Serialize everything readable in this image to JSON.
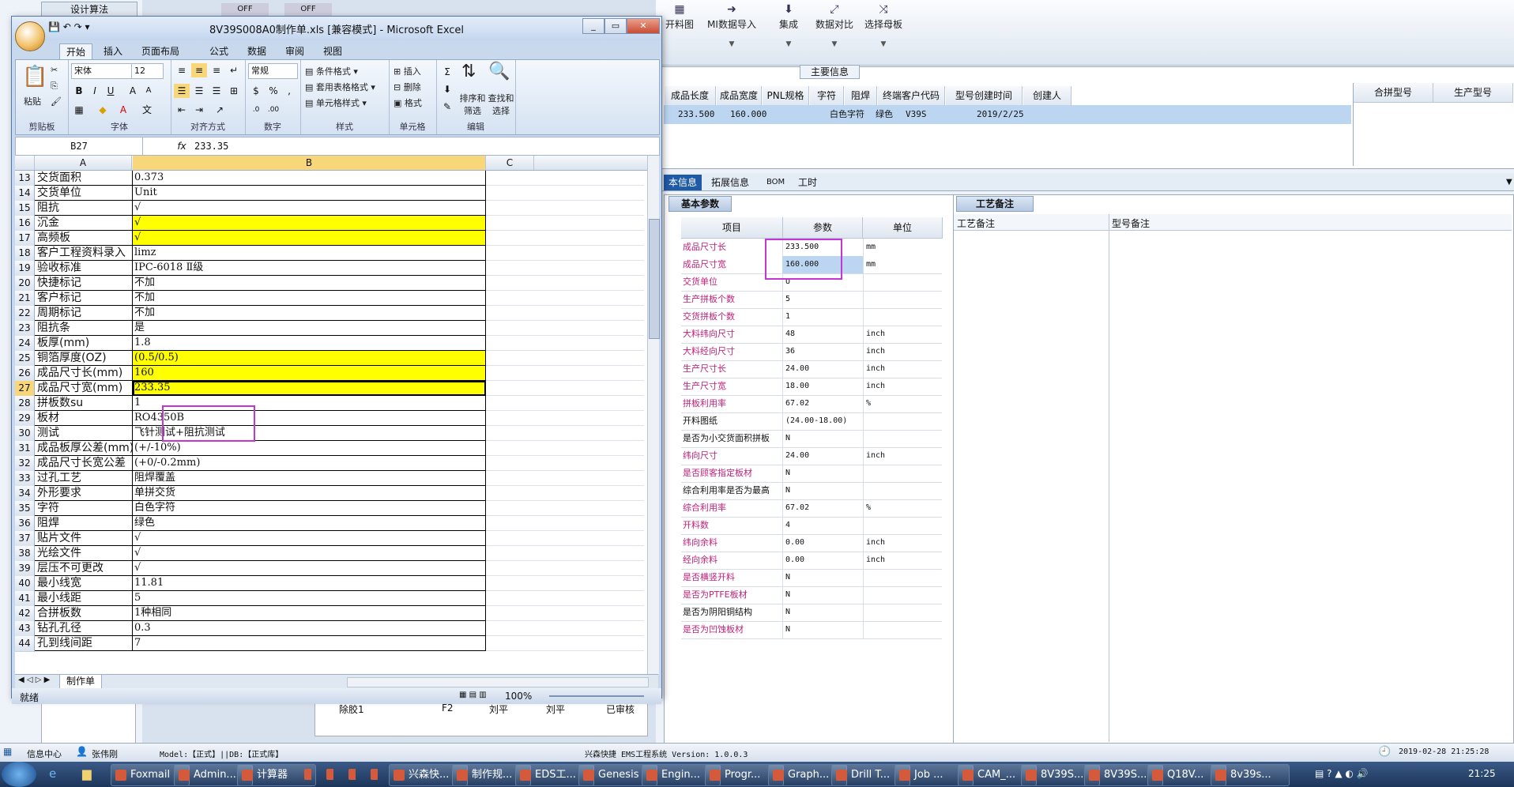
{
  "ems": {
    "top_left_label": "设计算法",
    "off1": "OFF",
    "off2": "OFF",
    "toolbar": [
      {
        "label": "开料图",
        "icon": "sheet-icon"
      },
      {
        "label": "MI数据导入",
        "icon": "import-icon"
      },
      {
        "label": "集成",
        "icon": "integrate-icon"
      },
      {
        "label": "数据对比",
        "icon": "compare-icon"
      },
      {
        "label": "选择母板",
        "icon": "select-board-icon"
      }
    ],
    "main_info_title": "主要信息",
    "main_grid": {
      "headers": [
        "成品长度",
        "成品宽度",
        "PNL规格",
        "字符",
        "阻焊",
        "终端客户代码",
        "型号创建时间",
        "创建人"
      ],
      "row": [
        "233.500",
        "160.000",
        "",
        "白色字符",
        "绿色",
        "V39S",
        "2019/2/25",
        ""
      ]
    },
    "right_grid_headers": [
      "合拼型号",
      "生产型号"
    ],
    "tabs": [
      "本信息",
      "拓展信息",
      "BOM",
      "工时"
    ],
    "basic_title": "基本参数",
    "param_headers": [
      "项目",
      "参数",
      "单位"
    ],
    "params": [
      {
        "name": "成品尺寸长",
        "value": "233.500",
        "unit": "mm",
        "pink": true
      },
      {
        "name": "成品尺寸宽",
        "value": "160.000",
        "unit": "mm",
        "pink": true
      },
      {
        "name": "交货单位",
        "value": "U",
        "unit": "",
        "pink": true
      },
      {
        "name": "生产拼板个数",
        "value": "5",
        "unit": "",
        "pink": true
      },
      {
        "name": "交货拼板个数",
        "value": "1",
        "unit": "",
        "pink": true
      },
      {
        "name": "大料纬向尺寸",
        "value": "48",
        "unit": "inch",
        "pink": true
      },
      {
        "name": "大料经向尺寸",
        "value": "36",
        "unit": "inch",
        "pink": true
      },
      {
        "name": "生产尺寸长",
        "value": "24.00",
        "unit": "inch",
        "pink": true
      },
      {
        "name": "生产尺寸宽",
        "value": "18.00",
        "unit": "inch",
        "pink": true
      },
      {
        "name": "拼板利用率",
        "value": "67.02",
        "unit": "%",
        "pink": true
      },
      {
        "name": "开料图纸",
        "value": "(24.00-18.00)",
        "unit": "",
        "pink": false
      },
      {
        "name": "是否为小交货面积拼板",
        "value": "N",
        "unit": "",
        "pink": false
      },
      {
        "name": "纬向尺寸",
        "value": "24.00",
        "unit": "inch",
        "pink": true
      },
      {
        "name": "是否顾客指定板材",
        "value": "N",
        "unit": "",
        "pink": true
      },
      {
        "name": "综合利用率是否为最高",
        "value": "N",
        "unit": "",
        "pink": false
      },
      {
        "name": "综合利用率",
        "value": "67.02",
        "unit": "%",
        "pink": true
      },
      {
        "name": "开料数",
        "value": "4",
        "unit": "",
        "pink": true
      },
      {
        "name": "纬向余料",
        "value": "0.00",
        "unit": "inch",
        "pink": true
      },
      {
        "name": "经向余料",
        "value": "0.00",
        "unit": "inch",
        "pink": true
      },
      {
        "name": "是否横竖开料",
        "value": "N",
        "unit": "",
        "pink": true
      },
      {
        "name": "是否为PTFE板材",
        "value": "N",
        "unit": "",
        "pink": true
      },
      {
        "name": "是否为阴阳铜结构",
        "value": "N",
        "unit": "",
        "pink": false
      },
      {
        "name": "是否为凹蚀板材",
        "value": "N",
        "unit": "",
        "pink": true
      }
    ],
    "remark_title": "工艺备注",
    "remark_headers": [
      "工艺备注",
      "型号备注"
    ],
    "tree_item": "除胶1",
    "tree_cols": [
      "F2",
      "刘平",
      "刘平",
      "已审核"
    ],
    "status": {
      "info_center": "信息中心",
      "user": "张伟刚",
      "model": "Model:【正式】||DB:【正式库】",
      "system": "兴森快捷 EMS工程系统 Version: 1.0.0.3",
      "datetime": "2019-02-28 21:25:28"
    }
  },
  "excel": {
    "title": "8V39S008A0制作单.xls  [兼容模式] - Microsoft Excel",
    "ribbon_tabs": [
      "开始",
      "插入",
      "页面布局",
      "公式",
      "数据",
      "审阅",
      "视图"
    ],
    "groups": [
      "剪贴板",
      "字体",
      "对齐方式",
      "数字",
      "样式",
      "单元格",
      "编辑"
    ],
    "paste": "粘贴",
    "font_name": "宋体",
    "font_size": "12",
    "number_format": "常规",
    "style_items": [
      "条件格式",
      "套用表格格式",
      "单元格样式"
    ],
    "cell_items": [
      "插入",
      "删除",
      "格式"
    ],
    "edit_items": [
      "排序和筛选",
      "查找和选择"
    ],
    "name_box": "B27",
    "fx": "fx",
    "formula": "233.35",
    "columns": [
      "A",
      "B",
      "C"
    ],
    "rows": [
      {
        "n": "13",
        "a": "交货面积",
        "b": "0.373",
        "y": false
      },
      {
        "n": "14",
        "a": "交货单位",
        "b": "Unit",
        "y": false
      },
      {
        "n": "15",
        "a": "阻抗",
        "b": "√",
        "y": false
      },
      {
        "n": "16",
        "a": "沉金",
        "b": "√",
        "y": true
      },
      {
        "n": "17",
        "a": "高频板",
        "b": "√",
        "y": true
      },
      {
        "n": "18",
        "a": "客户工程资料录入",
        "b": "limz",
        "y": false
      },
      {
        "n": "19",
        "a": "验收标准",
        "b": "IPC-6018 Ⅱ级",
        "y": false
      },
      {
        "n": "20",
        "a": "快捷标记",
        "b": "不加",
        "y": false
      },
      {
        "n": "21",
        "a": "客户标记",
        "b": "不加",
        "y": false
      },
      {
        "n": "22",
        "a": "周期标记",
        "b": "不加",
        "y": false
      },
      {
        "n": "23",
        "a": "阻抗条",
        "b": "是",
        "y": false
      },
      {
        "n": "24",
        "a": "板厚(mm)",
        "b": "1.8",
        "y": false
      },
      {
        "n": "25",
        "a": "铜箔厚度(OZ)",
        "b": "(0.5/0.5)",
        "y": true
      },
      {
        "n": "26",
        "a": "成品尺寸长(mm)",
        "b": "160",
        "y": true
      },
      {
        "n": "27",
        "a": "成品尺寸宽(mm)",
        "b": "233.35",
        "y": true
      },
      {
        "n": "28",
        "a": "拼板数su",
        "b": "1",
        "y": false
      },
      {
        "n": "29",
        "a": "板材",
        "b": "RO4350B",
        "y": false
      },
      {
        "n": "30",
        "a": "测试",
        "b": "飞针测试+阻抗测试",
        "y": false
      },
      {
        "n": "31",
        "a": "成品板厚公差(mm)",
        "b": "(+/-10%)",
        "y": false
      },
      {
        "n": "32",
        "a": "成品尺寸长宽公差",
        "b": "(+0/-0.2mm)",
        "y": false
      },
      {
        "n": "33",
        "a": "过孔工艺",
        "b": "阻焊覆盖",
        "y": false
      },
      {
        "n": "34",
        "a": "外形要求",
        "b": "单拼交货",
        "y": false
      },
      {
        "n": "35",
        "a": "字符",
        "b": "白色字符",
        "y": false
      },
      {
        "n": "36",
        "a": "阻焊",
        "b": "绿色",
        "y": false
      },
      {
        "n": "37",
        "a": "贴片文件",
        "b": "√",
        "y": false
      },
      {
        "n": "38",
        "a": "光绘文件",
        "b": "√",
        "y": false
      },
      {
        "n": "39",
        "a": "层压不可更改",
        "b": "√",
        "y": false
      },
      {
        "n": "40",
        "a": "最小线宽",
        "b": "11.81",
        "y": false
      },
      {
        "n": "41",
        "a": "最小线距",
        "b": "5",
        "y": false
      },
      {
        "n": "42",
        "a": "合拼板数",
        "b": "1种相同",
        "y": false
      },
      {
        "n": "43",
        "a": "钻孔孔径",
        "b": "0.3",
        "y": false
      },
      {
        "n": "44",
        "a": "孔到线间距",
        "b": "7",
        "y": false
      }
    ],
    "sheet_tab": "制作单",
    "status_ready": "就绪",
    "zoom": "100%"
  },
  "taskbar": {
    "items": [
      "Foxmail",
      "Admin...",
      "计算器",
      "",
      "",
      "",
      "",
      "兴森快...",
      "制作规...",
      "EDS工...",
      "Genesis",
      "Engin...",
      "Progr...",
      "Graph...",
      "Drill T...",
      "Job ...",
      "CAM_...",
      "8V39S...",
      "8V39S...",
      "Q18V...",
      "8v39s..."
    ],
    "clock": "21:25"
  }
}
